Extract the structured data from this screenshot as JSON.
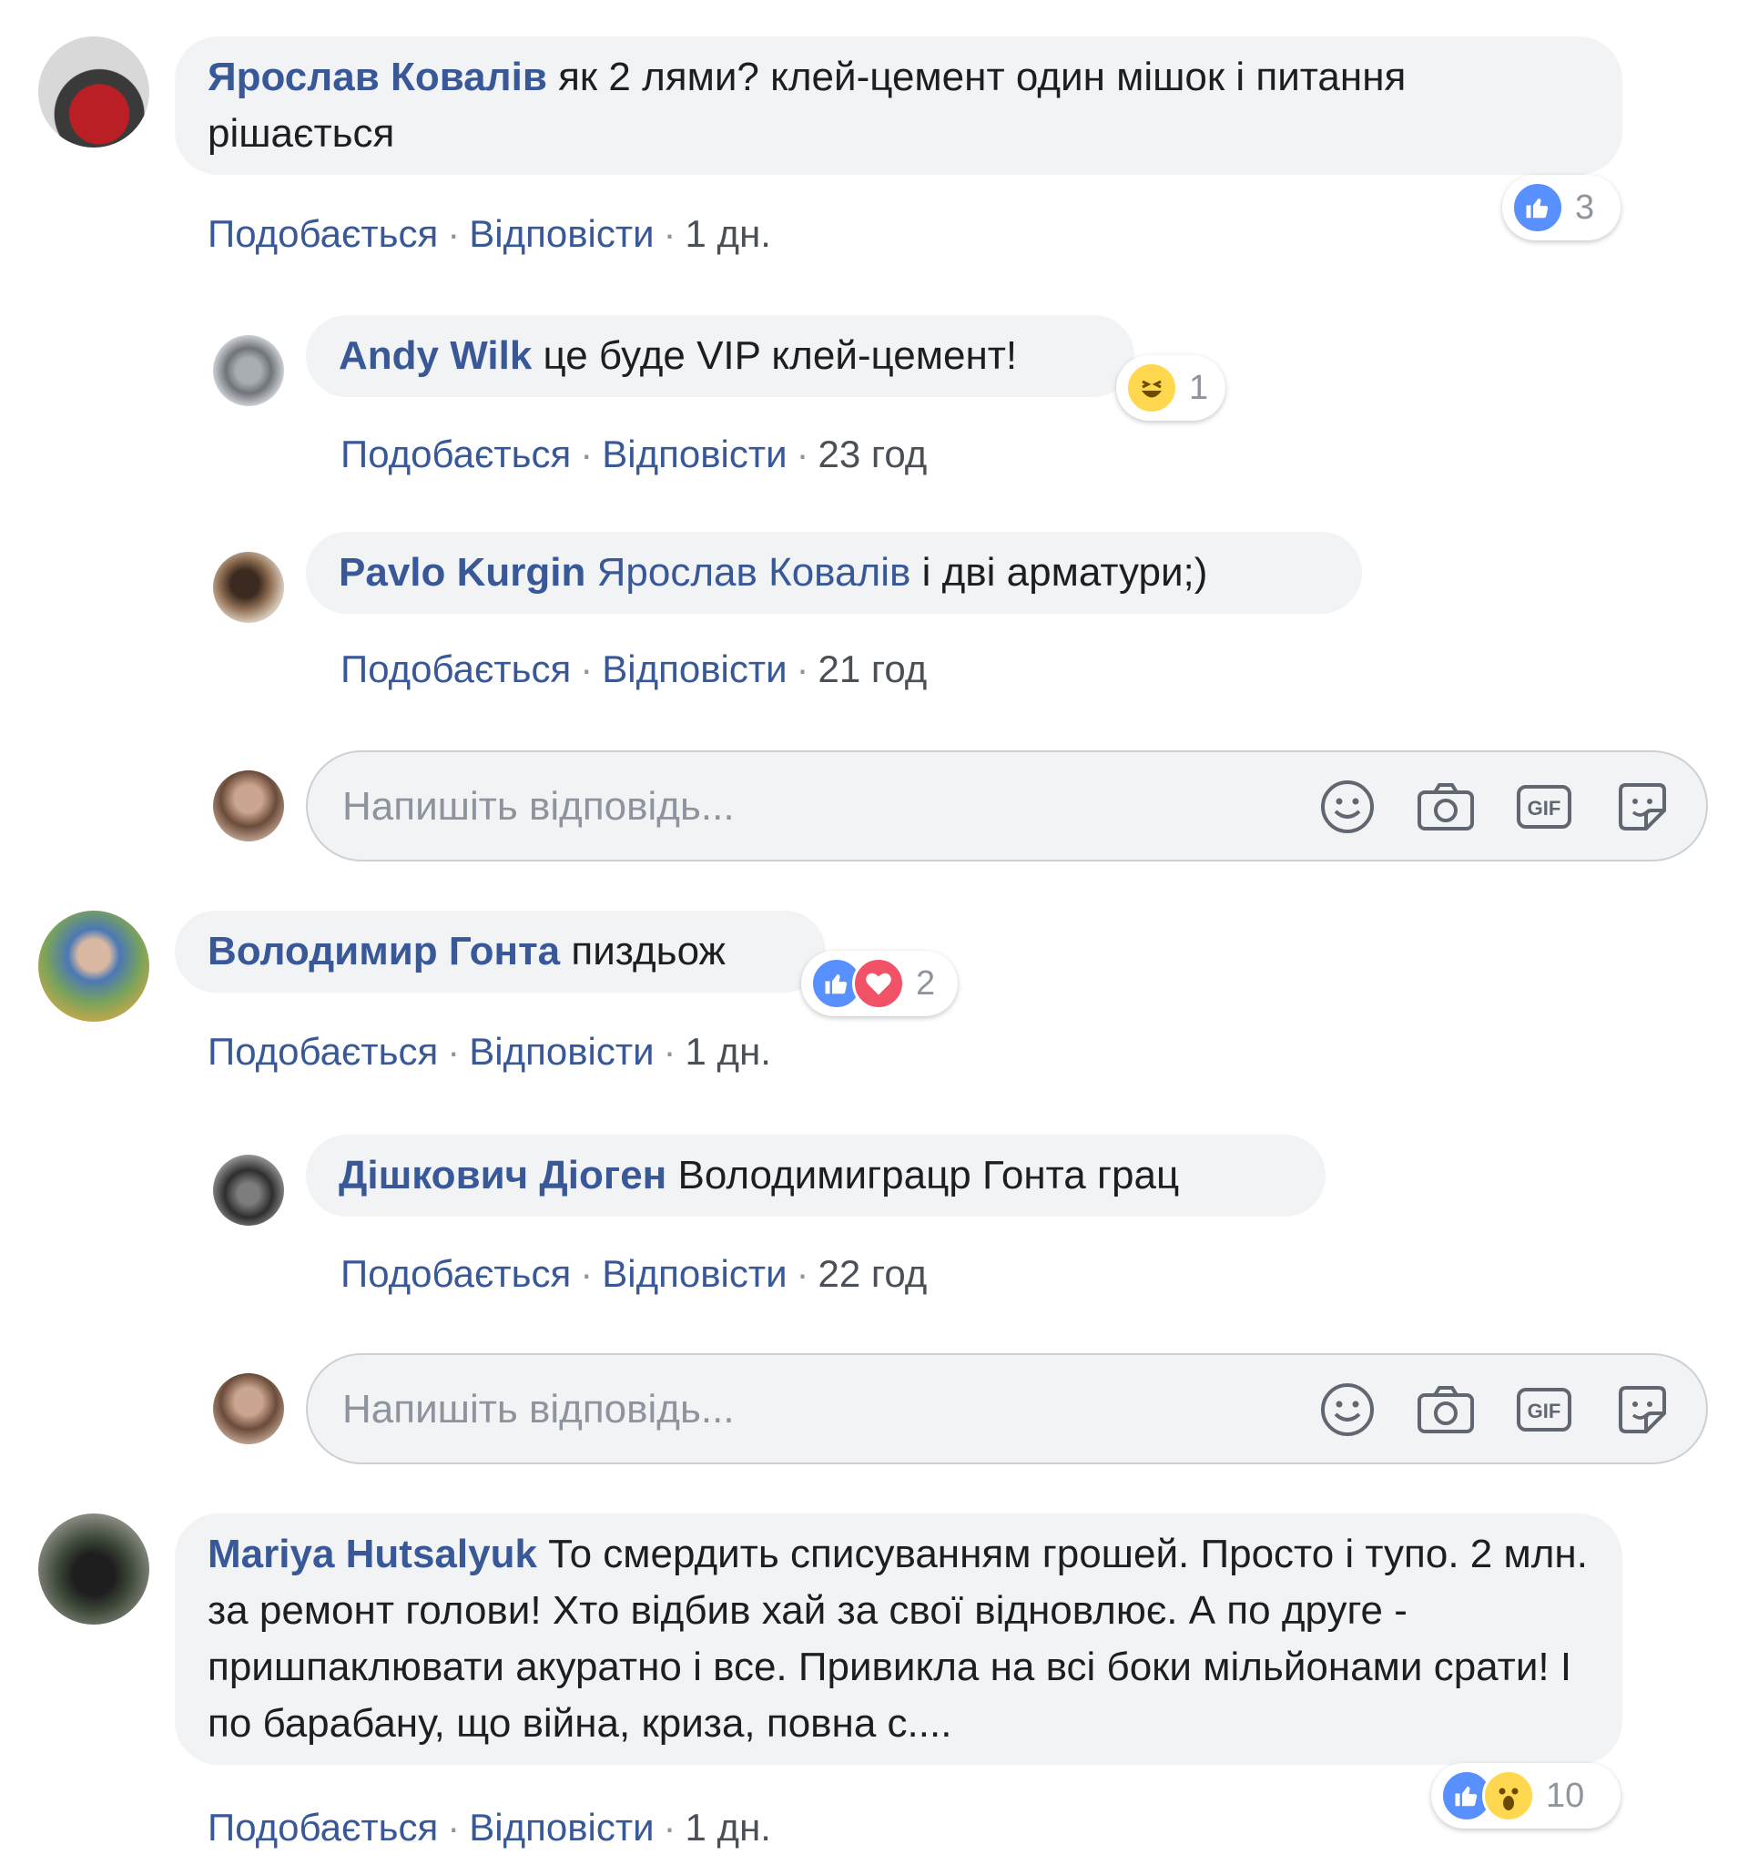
{
  "comments": [
    {
      "author": "Ярослав Ковалів",
      "text": "як 2 лями? клей-цемент один мішок і питання рішається",
      "reaction_count": "3",
      "reactions": [
        "like"
      ],
      "actions": {
        "like": "Подобається",
        "reply": "Відповісти",
        "time": "1 дн."
      },
      "replies": [
        {
          "author": "Andy Wilk",
          "text": "це буде VIP клей-цемент!",
          "reaction_count": "1",
          "reactions": [
            "haha"
          ],
          "actions": {
            "like": "Подобається",
            "reply": "Відповісти",
            "time": "23 год"
          }
        },
        {
          "author": "Pavlo Kurgin",
          "mention": "Ярослав Ковалів",
          "text": "і дві арматури;)",
          "actions": {
            "like": "Подобається",
            "reply": "Відповісти",
            "time": "21 год"
          }
        }
      ]
    },
    {
      "author": "Володимир Гонта",
      "text": "пиздьож",
      "reaction_count": "2",
      "reactions": [
        "like",
        "love"
      ],
      "actions": {
        "like": "Подобається",
        "reply": "Відповісти",
        "time": "1 дн."
      },
      "replies": [
        {
          "author": "Дішкович Діоген",
          "text": "Володимиграцр Гонта грац",
          "actions": {
            "like": "Подобається",
            "reply": "Відповісти",
            "time": "22 год"
          }
        }
      ]
    },
    {
      "author": "Mariya Hutsalyuk",
      "text": "То смердить списуванням грошей. Просто і тупо. 2 млн. за ремонт голови! Хто відбив хай за свої відновлює. А по друге - пришпаклювати акуратно і все. Привикла на всі боки мільйонами срати! І по барабану, що війна, криза, повна с....",
      "reaction_count": "10",
      "reactions": [
        "like",
        "wow"
      ],
      "actions": {
        "like": "Подобається",
        "reply": "Відповісти",
        "time": "1 дн."
      }
    }
  ],
  "reply_box": {
    "placeholder": "Напишіть відповідь...",
    "tools": [
      "emoji-icon",
      "camera-icon",
      "gif-icon",
      "sticker-icon"
    ]
  },
  "colors": {
    "name": "#385898",
    "bubble": "#f2f3f5",
    "like": "#5890ff",
    "love": "#f25268",
    "haha": "#ffd84f"
  }
}
